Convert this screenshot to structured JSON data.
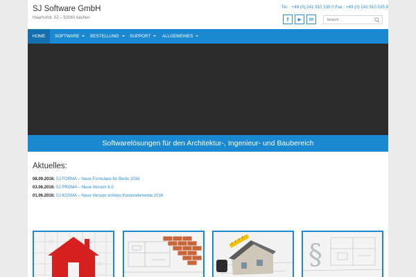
{
  "header": {
    "site_title": "SJ Software GmbH",
    "tagline": "Haarhofstr. 52 – 52080 Aachen",
    "contact": "Tel. : +49 (0) 241 910 535 0 Fax : +49 (0) 241 910 535 9",
    "socials": [
      {
        "icon": "facebook-icon",
        "glyph": "f"
      },
      {
        "icon": "youtube-icon",
        "glyph": "▶"
      },
      {
        "icon": "linkedin-icon",
        "glyph": "in"
      }
    ],
    "search": {
      "placeholder": "Search..."
    }
  },
  "nav": {
    "items": [
      {
        "label": "HOME",
        "active": true
      },
      {
        "label": "SOFTWARE",
        "has_dropdown": true
      },
      {
        "label": "BESTELLUNG",
        "has_dropdown": true
      },
      {
        "label": "SUPPORT",
        "has_dropdown": true
      },
      {
        "label": "ALLGEMEINES",
        "has_dropdown": true
      }
    ]
  },
  "banner": {
    "text": "Softwarelösungen für den Architektur-, Ingenieur- und Baubereich"
  },
  "news": {
    "heading": "Aktuelles:",
    "items": [
      {
        "date": "08.09.2016:",
        "text": "SJ FORMA – Neue Formulare für Berlin 2016"
      },
      {
        "date": "03.06.2016:",
        "text": "SJ PROMA – Neue Version 6.0"
      },
      {
        "date": "01.06.2016:",
        "text": "SJ KOSMA – Neue Version sirAdos Kostenelemente 2016"
      }
    ]
  },
  "colors": {
    "accent": "#1b88d2",
    "link": "#2a8bd6",
    "slider_bg": "#2b2b2b"
  }
}
